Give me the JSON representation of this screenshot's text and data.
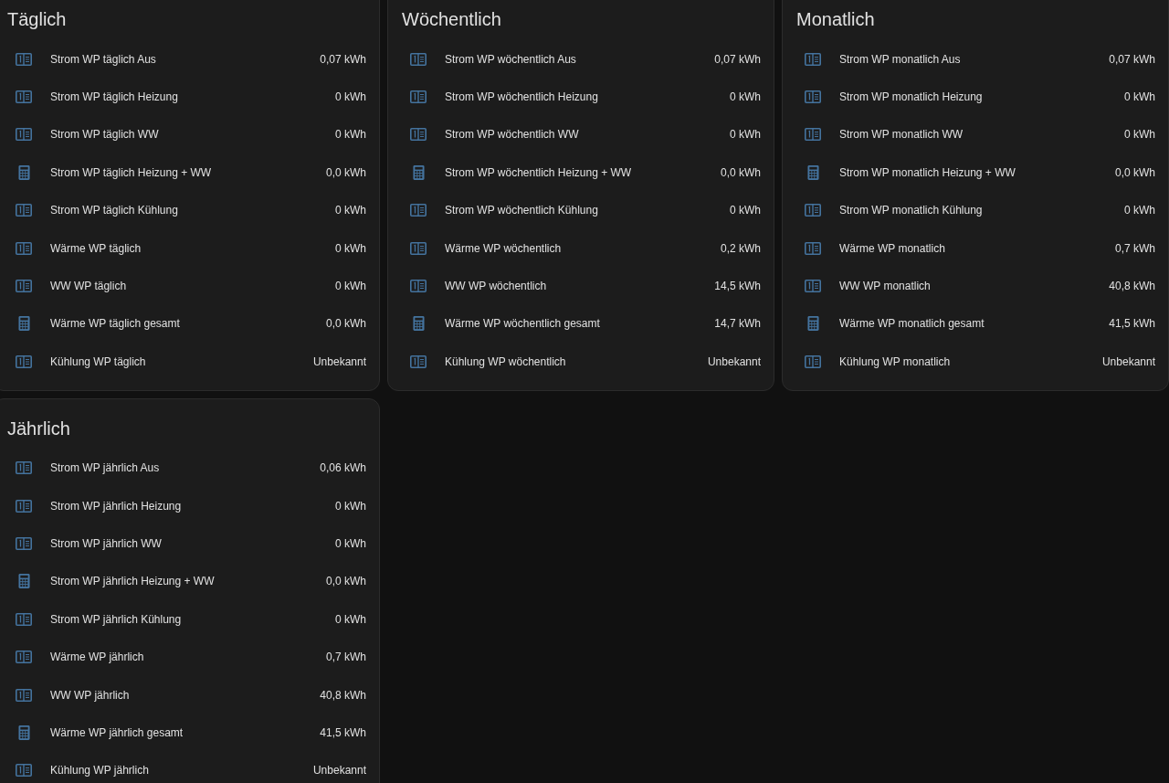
{
  "cards": [
    {
      "title": "Täglich",
      "rows": [
        {
          "kind": "counter",
          "name": "Strom WP täglich Aus",
          "value": "0,07 kWh"
        },
        {
          "kind": "counter",
          "name": "Strom WP täglich Heizung",
          "value": "0 kWh"
        },
        {
          "kind": "counter",
          "name": "Strom WP täglich WW",
          "value": "0 kWh"
        },
        {
          "kind": "calculator",
          "name": "Strom WP täglich Heizung + WW",
          "value": "0,0 kWh"
        },
        {
          "kind": "counter",
          "name": "Strom WP täglich Kühlung",
          "value": "0 kWh"
        },
        {
          "kind": "counter",
          "name": "Wärme WP täglich",
          "value": "0 kWh"
        },
        {
          "kind": "counter",
          "name": "WW WP täglich",
          "value": "0 kWh"
        },
        {
          "kind": "calculator",
          "name": "Wärme WP täglich gesamt",
          "value": "0,0 kWh"
        },
        {
          "kind": "counter",
          "name": "Kühlung WP täglich",
          "value": "Unbekannt"
        }
      ]
    },
    {
      "title": "Wöchentlich",
      "rows": [
        {
          "kind": "counter",
          "name": "Strom WP wöchentlich Aus",
          "value": "0,07 kWh"
        },
        {
          "kind": "counter",
          "name": "Strom WP wöchentlich Heizung",
          "value": "0 kWh"
        },
        {
          "kind": "counter",
          "name": "Strom WP wöchentlich WW",
          "value": "0 kWh"
        },
        {
          "kind": "calculator",
          "name": "Strom WP wöchentlich Heizung + WW",
          "value": "0,0 kWh"
        },
        {
          "kind": "counter",
          "name": "Strom WP wöchentlich Kühlung",
          "value": "0 kWh"
        },
        {
          "kind": "counter",
          "name": "Wärme WP wöchentlich",
          "value": "0,2 kWh"
        },
        {
          "kind": "counter",
          "name": "WW WP wöchentlich",
          "value": "14,5 kWh"
        },
        {
          "kind": "calculator",
          "name": "Wärme WP wöchentlich gesamt",
          "value": "14,7 kWh"
        },
        {
          "kind": "counter",
          "name": "Kühlung WP wöchentlich",
          "value": "Unbekannt"
        }
      ]
    },
    {
      "title": "Monatlich",
      "rows": [
        {
          "kind": "counter",
          "name": "Strom WP monatlich Aus",
          "value": "0,07 kWh"
        },
        {
          "kind": "counter",
          "name": "Strom WP monatlich Heizung",
          "value": "0 kWh"
        },
        {
          "kind": "counter",
          "name": "Strom WP monatlich WW",
          "value": "0 kWh"
        },
        {
          "kind": "calculator",
          "name": "Strom WP monatlich Heizung + WW",
          "value": "0,0 kWh"
        },
        {
          "kind": "counter",
          "name": "Strom WP monatlich Kühlung",
          "value": "0 kWh"
        },
        {
          "kind": "counter",
          "name": "Wärme WP monatlich",
          "value": "0,7 kWh"
        },
        {
          "kind": "counter",
          "name": "WW WP monatlich",
          "value": "40,8 kWh"
        },
        {
          "kind": "calculator",
          "name": "Wärme WP monatlich gesamt",
          "value": "41,5 kWh"
        },
        {
          "kind": "counter",
          "name": "Kühlung WP monatlich",
          "value": "Unbekannt"
        }
      ]
    },
    {
      "title": "Jährlich",
      "rows": [
        {
          "kind": "counter",
          "name": "Strom WP jährlich Aus",
          "value": "0,06 kWh"
        },
        {
          "kind": "counter",
          "name": "Strom WP jährlich Heizung",
          "value": "0 kWh"
        },
        {
          "kind": "counter",
          "name": "Strom WP jährlich WW",
          "value": "0 kWh"
        },
        {
          "kind": "calculator",
          "name": "Strom WP jährlich Heizung + WW",
          "value": "0,0 kWh"
        },
        {
          "kind": "counter",
          "name": "Strom WP jährlich Kühlung",
          "value": "0 kWh"
        },
        {
          "kind": "counter",
          "name": "Wärme WP jährlich",
          "value": "0,7 kWh"
        },
        {
          "kind": "counter",
          "name": "WW WP jährlich",
          "value": "40,8 kWh"
        },
        {
          "kind": "calculator",
          "name": "Wärme WP jährlich gesamt",
          "value": "41,5 kWh"
        },
        {
          "kind": "counter",
          "name": "Kühlung WP jährlich",
          "value": "Unbekannt"
        }
      ]
    }
  ]
}
